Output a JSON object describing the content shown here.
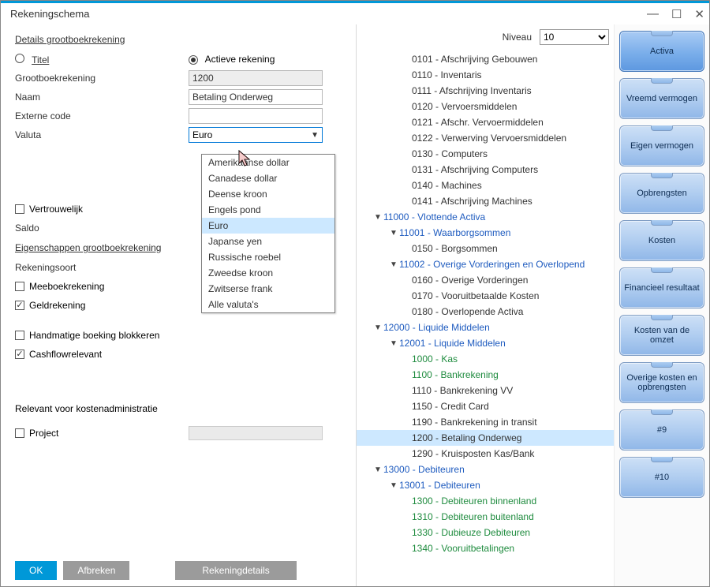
{
  "window": {
    "title": "Rekeningschema",
    "min": "—",
    "max": "☐",
    "close": "✕"
  },
  "left": {
    "section1": "Details grootboekrekening",
    "titel_label": "Titel",
    "actieve_label": "Actieve rekening",
    "gbr_label": "Grootboekrekening",
    "gbr_val": "1200",
    "naam_label": "Naam",
    "naam_val": "Betaling Onderweg",
    "externe_label": "Externe code",
    "externe_val": "",
    "valuta_label": "Valuta",
    "valuta_val": "Euro",
    "valuta_options": [
      "Amerikaanse dollar",
      "Canadese dollar",
      "Deense kroon",
      "Engels pond",
      "Euro",
      "Japanse yen",
      "Russische roebel",
      "Zweedse kroon",
      "Zwitserse frank",
      "Alle valuta's"
    ],
    "vertrouw_label": "Vertrouwelijk",
    "saldo_label": "Saldo",
    "section2": "Eigenschappen grootboekrekening",
    "reksoort_label": "Rekeningsoort",
    "meeboek_label": "Meeboekrekening",
    "geldrek_label": "Geldrekening",
    "handmatig_label": "Handmatige boeking blokkeren",
    "cashflow_label": "Cashflowrelevant",
    "relevant_hdr": "Relevant voor kostenadministratie",
    "project_label": "Project"
  },
  "niveau": {
    "label": "Niveau",
    "value": "10"
  },
  "tree": [
    {
      "t": "0101 - Afschrijving Gebouwen",
      "ind": 70
    },
    {
      "t": "0110 - Inventaris",
      "ind": 70
    },
    {
      "t": "0111 - Afschrijving Inventaris",
      "ind": 70
    },
    {
      "t": "0120 - Vervoersmiddelen",
      "ind": 70
    },
    {
      "t": "0121 - Afschr. Vervoermiddelen",
      "ind": 70
    },
    {
      "t": "0122 - Verwerving Vervoersmiddelen",
      "ind": 70
    },
    {
      "t": "0130 - Computers",
      "ind": 70
    },
    {
      "t": "0131 - Afschrijving Computers",
      "ind": 70
    },
    {
      "t": "0140 - Machines",
      "ind": 70
    },
    {
      "t": "0141 - Afschrijving Machines",
      "ind": 70
    },
    {
      "t": "11000 - Vlottende Activa",
      "ind": 20,
      "arrow": true,
      "cls": "blue"
    },
    {
      "t": "11001 - Waarborgsommen",
      "ind": 40,
      "arrow": true,
      "cls": "blue"
    },
    {
      "t": "0150 - Borgsommen",
      "ind": 70
    },
    {
      "t": "11002 - Overige Vorderingen en Overlopend",
      "ind": 40,
      "arrow": true,
      "cls": "blue"
    },
    {
      "t": "0160 - Overige Vorderingen",
      "ind": 70
    },
    {
      "t": "0170 - Vooruitbetaalde Kosten",
      "ind": 70
    },
    {
      "t": "0180 - Overlopende Activa",
      "ind": 70
    },
    {
      "t": "12000 - Liquide Middelen",
      "ind": 20,
      "arrow": true,
      "cls": "blue"
    },
    {
      "t": "12001 - Liquide Middelen",
      "ind": 40,
      "arrow": true,
      "cls": "blue"
    },
    {
      "t": "1000 - Kas",
      "ind": 70,
      "cls": "green"
    },
    {
      "t": "1100 - Bankrekening",
      "ind": 70,
      "cls": "green"
    },
    {
      "t": "1110 - Bankrekening VV",
      "ind": 70
    },
    {
      "t": "1150 - Credit Card",
      "ind": 70
    },
    {
      "t": "1190 - Bankrekening in transit",
      "ind": 70
    },
    {
      "t": "1200 - Betaling Onderweg",
      "ind": 70,
      "sel": true
    },
    {
      "t": "1290 - Kruisposten Kas/Bank",
      "ind": 70
    },
    {
      "t": "13000 - Debiteuren",
      "ind": 20,
      "arrow": true,
      "cls": "blue"
    },
    {
      "t": "13001 - Debiteuren",
      "ind": 40,
      "arrow": true,
      "cls": "blue"
    },
    {
      "t": "1300 - Debiteuren binnenland",
      "ind": 70,
      "cls": "green"
    },
    {
      "t": "1310 - Debiteuren buitenland",
      "ind": 70,
      "cls": "green"
    },
    {
      "t": "1330 - Dubieuze Debiteuren",
      "ind": 70,
      "cls": "green"
    },
    {
      "t": "1340 - Vooruitbetalingen",
      "ind": 70,
      "cls": "green"
    }
  ],
  "side_tabs": [
    "Activa",
    "Vreemd vermogen",
    "Eigen vermogen",
    "Opbrengsten",
    "Kosten",
    "Financieel resultaat",
    "Kosten van de omzet",
    "Overige kosten en opbrengsten",
    "#9",
    "#10"
  ],
  "footer": {
    "ok": "OK",
    "cancel": "Afbreken",
    "details": "Rekeningdetails"
  }
}
